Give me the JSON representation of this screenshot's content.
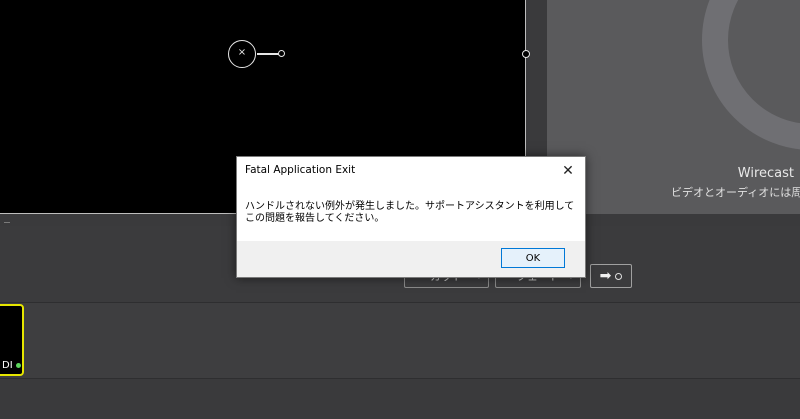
{
  "splash": {
    "title": "Wirecast",
    "subtitle": "ビデオとオーディオには周期"
  },
  "transitions": {
    "cut_label": "カット",
    "fade_label": "フェード",
    "go_icon": "arrow-right-icon"
  },
  "shot": {
    "label": "DI",
    "status_color": "#5cd65c",
    "highlight_color": "#e6e600"
  },
  "dialog": {
    "title": "Fatal Application Exit",
    "message": "ハンドルされない例外が発生しました。サポートアシスタントを利用してこの問題を報告してください。",
    "ok_label": "OK",
    "close_glyph": "✕"
  }
}
